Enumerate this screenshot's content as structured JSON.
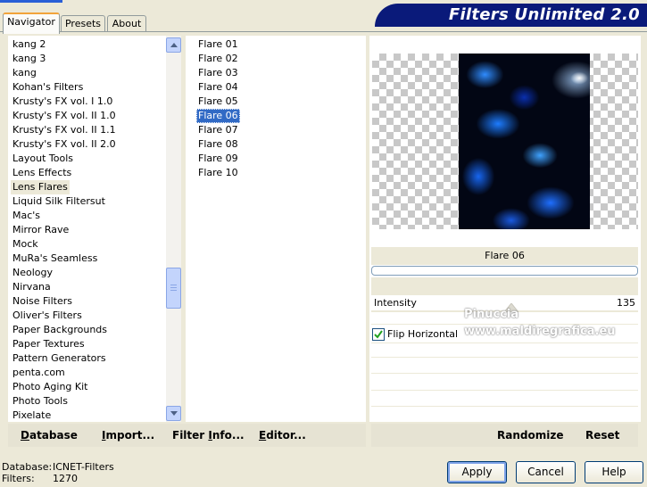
{
  "tabs": [
    "Navigator",
    "Presets",
    "About"
  ],
  "app_title": "Filters Unlimited 2.0",
  "categories": [
    "kang 2",
    "kang 3",
    "kang",
    "Kohan's Filters",
    "Krusty's FX vol. I 1.0",
    "Krusty's FX vol. II 1.0",
    "Krusty's FX vol. II 1.1",
    "Krusty's FX vol. II 2.0",
    "Layout Tools",
    "Lens Effects",
    "Lens Flares",
    "Liquid Silk Filtersut",
    "Mac's",
    "Mirror Rave",
    "Mock",
    "MuRa's Seamless",
    "Neology",
    "Nirvana",
    "Noise Filters",
    "Oliver's Filters",
    "Paper Backgrounds",
    "Paper Textures",
    "Pattern Generators",
    "penta.com",
    "Photo Aging Kit",
    "Photo Tools",
    "Pixelate"
  ],
  "selected_category": "Lens Flares",
  "filters": [
    "Flare 01",
    "Flare 02",
    "Flare 03",
    "Flare 04",
    "Flare 05",
    "Flare 06",
    "Flare 07",
    "Flare 08",
    "Flare 09",
    "Flare 10"
  ],
  "selected_filter": "Flare 06",
  "preview_label": "Flare 06",
  "params": {
    "intensity_label": "Intensity",
    "intensity_value": "135",
    "flip_label": "Flip Horizontal",
    "flip_checked": true
  },
  "watermark": "Pinuccia  www.maldiregrafica.eu",
  "toolbar": {
    "database": "Database",
    "import": "Import...",
    "filter_info": "Filter Info...",
    "editor": "Editor...",
    "randomize": "Randomize",
    "reset": "Reset"
  },
  "status": {
    "database_label": "Database:",
    "database_value": "ICNET-Filters",
    "filters_label": "Filters:",
    "filters_value": "1270"
  },
  "buttons": {
    "apply": "Apply",
    "cancel": "Cancel",
    "help": "Help"
  },
  "colors": {
    "banner": "#0a1a7a",
    "selection": "#316ac5",
    "tab_highlight": "#f1a33b"
  }
}
